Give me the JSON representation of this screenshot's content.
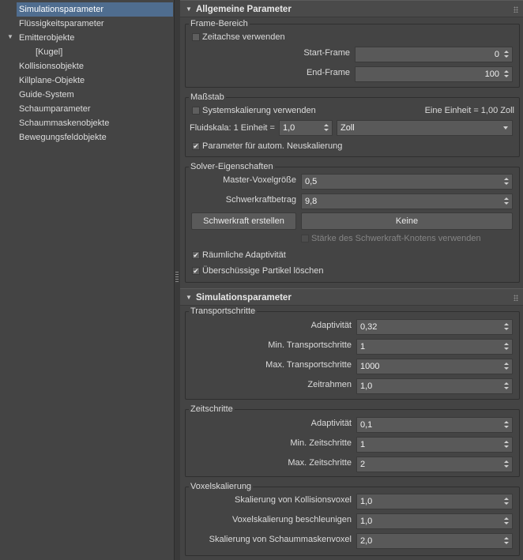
{
  "tree": {
    "items": [
      {
        "label": "Simulationsparameter",
        "selected": true
      },
      {
        "label": "Flüssigkeitsparameter"
      },
      {
        "label": "Emitterobjekte",
        "expanded": true
      },
      {
        "label": "[Kugel]"
      },
      {
        "label": "Kollisionsobjekte"
      },
      {
        "label": "Killplane-Objekte"
      },
      {
        "label": "Guide-System"
      },
      {
        "label": "Schaumparameter"
      },
      {
        "label": "Schaummaskenobjekte"
      },
      {
        "label": "Bewegungsfeldobjekte"
      }
    ]
  },
  "general": {
    "title": "Allgemeine Parameter",
    "frame_range": {
      "title": "Frame-Bereich",
      "use_timeline": "Zeitachse verwenden",
      "start_label": "Start-Frame",
      "start_value": "0",
      "end_label": "End-Frame",
      "end_value": "100"
    },
    "scale": {
      "title": "Maßstab",
      "use_system_scale": "Systemskalierung verwenden",
      "unit_info": "Eine Einheit = 1,00 Zoll",
      "fluid_scale_label": "Fluidskala: 1 Einheit =",
      "fluid_scale_value": "1,0",
      "unit_value": "Zoll",
      "auto_rescale": "Parameter für autom. Neuskalierung"
    },
    "solver": {
      "title": "Solver-Eigenschaften",
      "voxel_label": "Master-Voxelgröße",
      "voxel_value": "0,5",
      "gravity_label": "Schwerkraftbetrag",
      "gravity_value": "9,8",
      "create_gravity": "Schwerkraft erstellen",
      "gravity_node": "Keine",
      "use_gravity_node": "Stärke des Schwerkraft-Knotens verwenden",
      "spatial_adaptivity": "Räumliche Adaptivität",
      "delete_excess": "Überschüssige Partikel löschen"
    }
  },
  "simulation": {
    "title": "Simulationsparameter",
    "transport": {
      "title": "Transportschritte",
      "rows": [
        {
          "label": "Adaptivität",
          "value": "0,32"
        },
        {
          "label": "Min. Transportschritte",
          "value": "1"
        },
        {
          "label": "Max. Transportschritte",
          "value": "1000"
        },
        {
          "label": "Zeitrahmen",
          "value": "1,0"
        }
      ]
    },
    "timesteps": {
      "title": "Zeitschritte",
      "rows": [
        {
          "label": "Adaptivität",
          "value": "0,1"
        },
        {
          "label": "Min. Zeitschritte",
          "value": "1"
        },
        {
          "label": "Max. Zeitschritte",
          "value": "2"
        }
      ]
    },
    "voxel_scaling": {
      "title": "Voxelskalierung",
      "rows": [
        {
          "label": "Skalierung von Kollisionsvoxel",
          "value": "1,0"
        },
        {
          "label": "Voxelskalierung beschleunigen",
          "value": "1,0"
        },
        {
          "label": "Skalierung von Schaummaskenvoxel",
          "value": "2,0"
        }
      ]
    }
  }
}
